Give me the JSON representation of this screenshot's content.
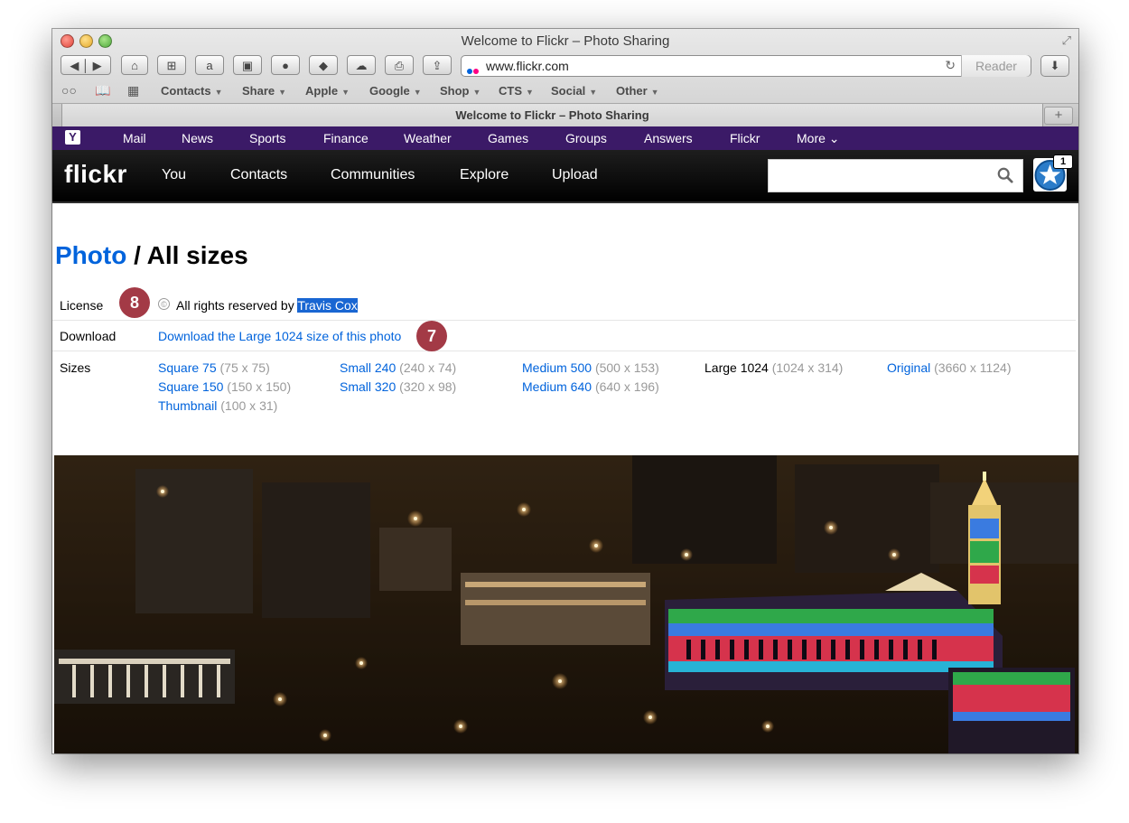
{
  "window": {
    "title": "Welcome to Flickr – Photo Sharing"
  },
  "toolbar": {
    "url": "www.flickr.com",
    "reader_label": "Reader"
  },
  "bookmarks": [
    {
      "label": "Contacts"
    },
    {
      "label": "Share"
    },
    {
      "label": "Apple"
    },
    {
      "label": "Google"
    },
    {
      "label": "Shop"
    },
    {
      "label": "CTS"
    },
    {
      "label": "Social"
    },
    {
      "label": "Other"
    }
  ],
  "tab": {
    "title": "Welcome to Flickr – Photo Sharing",
    "add_label": "+"
  },
  "yahoo_bar": {
    "logo": "Y",
    "links": [
      "Mail",
      "News",
      "Sports",
      "Finance",
      "Weather",
      "Games",
      "Groups",
      "Answers",
      "Flickr",
      "More ⌄"
    ]
  },
  "flickr_bar": {
    "logo": "flickr",
    "nav": [
      "You",
      "Contacts",
      "Communities",
      "Explore",
      "Upload"
    ],
    "search_placeholder": "",
    "notification_count": "1"
  },
  "page": {
    "heading_link": "Photo",
    "heading_rest": " / All sizes",
    "license_label": "License",
    "license_text": "All rights reserved by ",
    "license_owner": "Travis Cox",
    "download_label": "Download",
    "download_link": "Download the Large 1024 size of this photo",
    "sizes_label": "Sizes",
    "badge_license": "8",
    "badge_download": "7",
    "sizes": [
      {
        "name": "Square 75",
        "dims": "(75 x 75)"
      },
      {
        "name": "Square 150",
        "dims": "(150 x 150)"
      },
      {
        "name": "Thumbnail",
        "dims": "(100 x 31)"
      },
      {
        "name": "Small 240",
        "dims": "(240 x 74)"
      },
      {
        "name": "Small 320",
        "dims": "(320 x 98)"
      },
      {
        "name": "Medium 500",
        "dims": "(500 x 153)"
      },
      {
        "name": "Medium 640",
        "dims": "(640 x 196)"
      },
      {
        "name": "Large 1024",
        "dims": "(1024 x 314)",
        "current": true
      },
      {
        "name": "Original",
        "dims": "(3660 x 1124)"
      }
    ]
  },
  "colors": {
    "yahoo_purple": "#3b1a67",
    "flickr_blue": "#0063dc",
    "badge_red": "#a33a46"
  }
}
